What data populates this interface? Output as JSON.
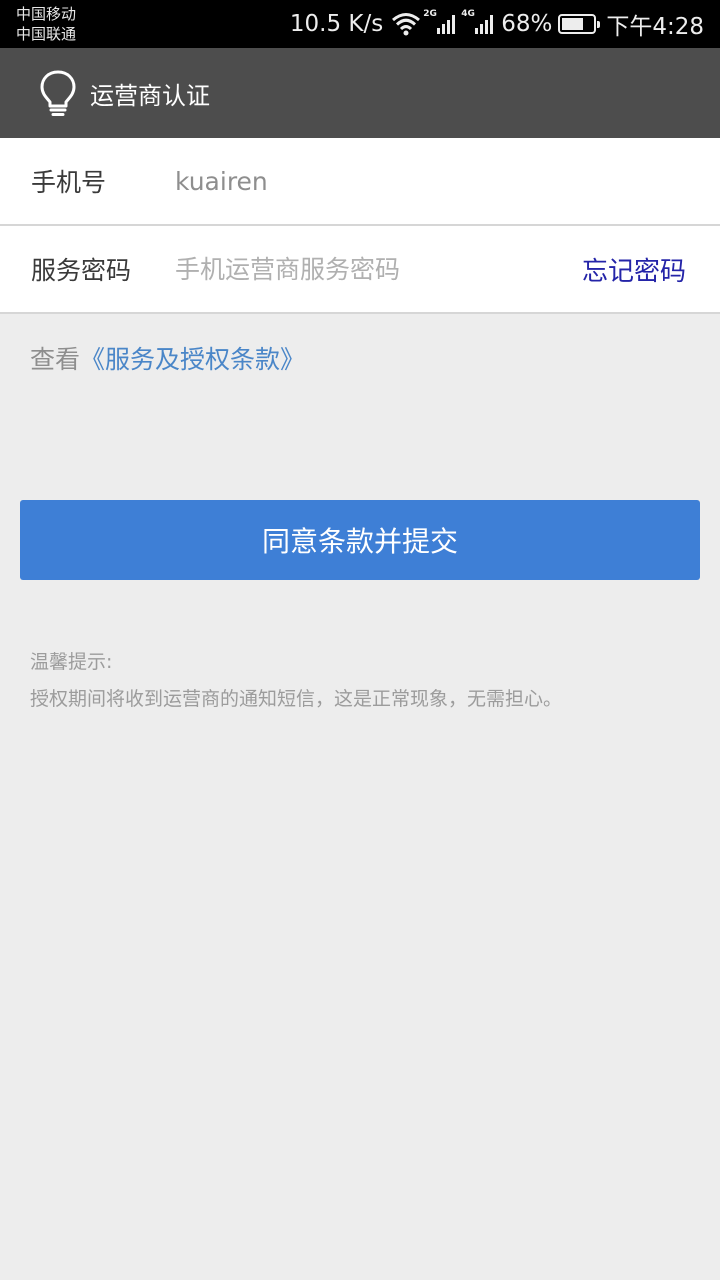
{
  "status_bar": {
    "carrier_1": "中国移动",
    "carrier_2": "中国联通",
    "net_speed": "10.5 K/s",
    "net_type_1": "2G",
    "net_type_2": "4G",
    "battery_percent": "68%",
    "battery_level": 0.68,
    "time": "下午4:28"
  },
  "header": {
    "title": "运营商认证",
    "icon": "lightbulb-icon",
    "background": "#4d4d4d"
  },
  "form": {
    "phone_label": "手机号",
    "phone_value": "kuairen",
    "password_label": "服务密码",
    "password_placeholder": "手机运营商服务密码",
    "forgot_password": "忘记密码"
  },
  "terms": {
    "prefix": "查看",
    "link": "《服务及授权条款》"
  },
  "submit_label": "同意条款并提交",
  "tips": {
    "title": "温馨提示:",
    "body": "授权期间将收到运营商的通知短信，这是正常现象，无需担心。"
  },
  "colors": {
    "accent": "#3e7fd6",
    "link": "#4a86c8",
    "forgot": "#2424a8",
    "page_background": "#ededed"
  }
}
